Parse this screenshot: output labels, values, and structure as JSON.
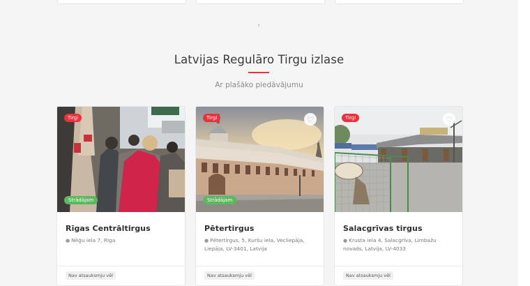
{
  "section": {
    "title": "Latvijas Regulāro Tirgu izlase",
    "subtitle": "Ar plašāko piedāvājumu"
  },
  "cards": [
    {
      "category": "Tirgi",
      "status": "Strādājam",
      "title": "Rīgas Centrāltirgus",
      "address": "Nēģu iela 7, Rīga",
      "reviews": "Nav atsauksmju vēl",
      "image_icon": "crowd-market-photo"
    },
    {
      "category": "Tirgi",
      "status": "Strādājam",
      "title": "Pētertirgus",
      "address": "Pētertirgus, 5, Kuršu iela, Vecliepāja, Liepāja, LV-3401, Latvija",
      "reviews": "Nav atsauksmju vēl",
      "image_icon": "building-photo"
    },
    {
      "category": "Tirgi",
      "status": "",
      "title": "Salacgrīvas tirgus",
      "address": "Krusta iela 4, Salacgrīva, Limbažu novads, Latvija, LV-4033",
      "reviews": "Nav atsauksmju vēl",
      "image_icon": "market-pavilion-photo"
    }
  ],
  "colors": {
    "accent": "#e8323c",
    "status_green": "#5cb85c",
    "background": "#f5f5f5"
  }
}
